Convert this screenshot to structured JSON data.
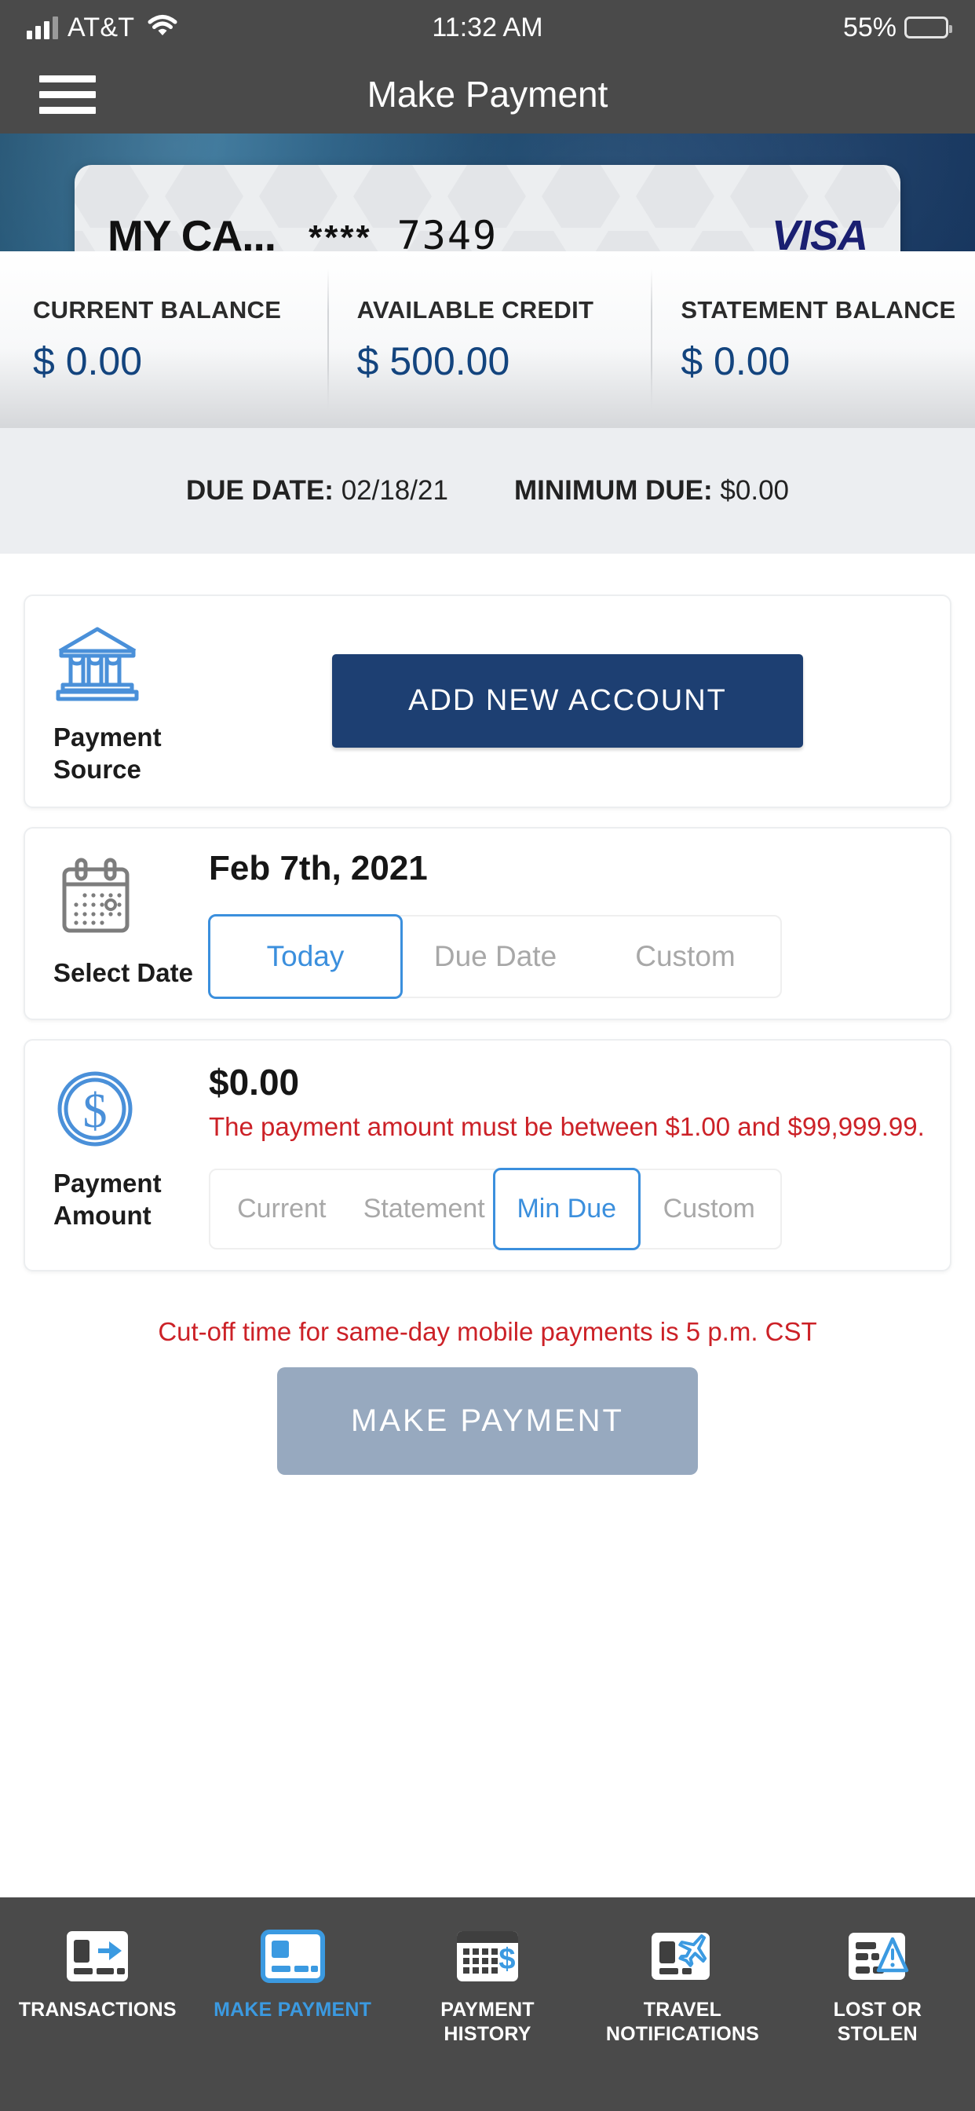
{
  "status_bar": {
    "carrier": "AT&T",
    "time": "11:32 AM",
    "battery_percent": "55%"
  },
  "nav": {
    "title": "Make Payment",
    "menu_icon": "hamburger-menu-icon"
  },
  "card": {
    "nickname": "MY CA...",
    "masked_number": "**** 7349",
    "mask_stars": "****",
    "last_four": "7349",
    "network": "VISA"
  },
  "balances": [
    {
      "label": "CURRENT BALANCE",
      "value": "$ 0.00"
    },
    {
      "label": "AVAILABLE CREDIT",
      "value": "$ 500.00"
    },
    {
      "label": "STATEMENT BALANCE",
      "value": "$ 0.00"
    }
  ],
  "due": {
    "due_date_label": "DUE DATE:",
    "due_date_value": "02/18/21",
    "minimum_due_label": "MINIMUM DUE:",
    "minimum_due_value": "$0.00"
  },
  "payment_source": {
    "label": "Payment\nSource",
    "label_line1": "Payment",
    "label_line2": "Source",
    "icon": "bank-institution-icon",
    "add_account_button": "ADD NEW ACCOUNT"
  },
  "select_date": {
    "label": "Select Date",
    "icon": "calendar-icon",
    "selected_date": "Feb 7th, 2021",
    "options": [
      {
        "label": "Today",
        "selected": true
      },
      {
        "label": "Due Date",
        "selected": false
      },
      {
        "label": "Custom",
        "selected": false
      }
    ]
  },
  "payment_amount": {
    "label_line1": "Payment",
    "label_line2": "Amount",
    "icon": "dollar-coin-icon",
    "amount": "$0.00",
    "error": "The payment amount must be between $1.00 and $99,999.99.",
    "options": [
      {
        "label": "Current",
        "selected": false
      },
      {
        "label": "Statement",
        "selected": false
      },
      {
        "label": "Min Due",
        "selected": true
      },
      {
        "label": "Custom",
        "selected": false
      }
    ]
  },
  "cutoff_notice": "Cut-off time for same-day mobile payments is 5 p.m. CST",
  "submit_button": "MAKE PAYMENT",
  "tabs": [
    {
      "label_line1": "TRANSACTIONS",
      "label_line2": "",
      "icon": "card-arrow-icon",
      "active": false
    },
    {
      "label_line1": "MAKE PAYMENT",
      "label_line2": "",
      "icon": "card-payment-icon",
      "active": true
    },
    {
      "label_line1": "PAYMENT",
      "label_line2": "HISTORY",
      "icon": "calendar-dollar-icon",
      "active": false
    },
    {
      "label_line1": "TRAVEL",
      "label_line2": "NOTIFICATIONS",
      "icon": "card-airplane-icon",
      "active": false
    },
    {
      "label_line1": "LOST OR",
      "label_line2": "STOLEN",
      "icon": "card-warning-icon",
      "active": false
    }
  ],
  "colors": {
    "accent_blue": "#3b8fdd",
    "navy": "#1d3f72",
    "balance_navy": "#13447e",
    "error_red": "#cc2127",
    "chrome_gray": "#4a4a4a",
    "disabled_button": "#97a9bf"
  }
}
